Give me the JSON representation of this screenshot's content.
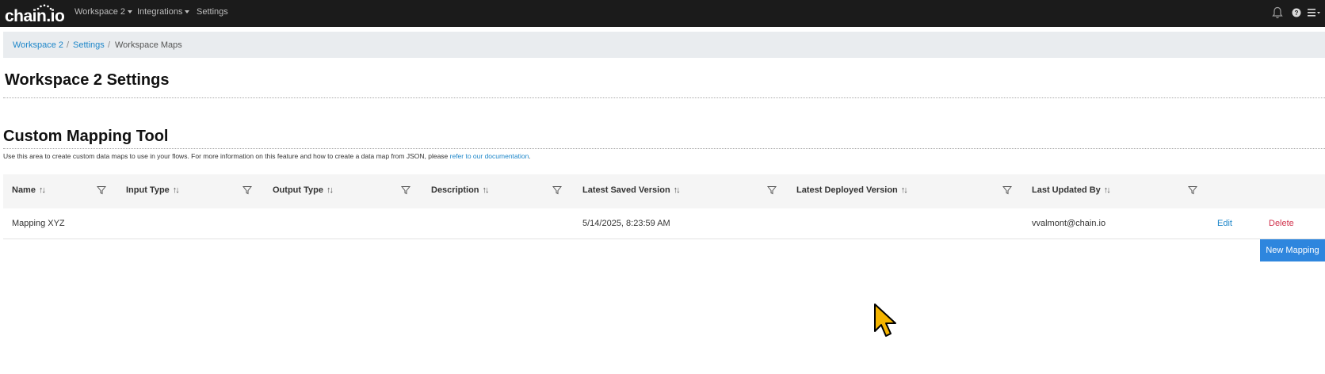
{
  "app": {
    "logo_text": "chain.io"
  },
  "nav": {
    "workspace_label": "Workspace 2",
    "integrations_label": "Integrations",
    "settings_label": "Settings"
  },
  "breadcrumb": {
    "items": [
      "Workspace 2",
      "Settings",
      "Workspace Maps"
    ],
    "separator": "/"
  },
  "page": {
    "title": "Workspace 2 Settings"
  },
  "section": {
    "title": "Custom Mapping Tool",
    "description": "Use this area to create custom data maps to use in your flows. For more information on this feature and how to create a data map from JSON, please ",
    "doc_link": "refer to our documentation",
    "doc_suffix": "."
  },
  "table": {
    "columns": [
      "Name",
      "Input Type",
      "Output Type",
      "Description",
      "Latest Saved Version",
      "Latest Deployed Version",
      "Last Updated By"
    ],
    "rows": [
      {
        "name": "Mapping XYZ",
        "input_type": "",
        "output_type": "",
        "description": "",
        "latest_saved_version": "5/14/2025, 8:23:59 AM",
        "latest_deployed_version": "",
        "last_updated_by": "vvalmont@chain.io",
        "edit_label": "Edit",
        "delete_label": "Delete"
      }
    ]
  },
  "actions": {
    "new_mapping_label": "New Mapping"
  },
  "icons": {
    "notifications": "bell-icon",
    "help": "help-icon",
    "menu": "hamburger-menu-icon",
    "sort": "sort-icon",
    "filter": "filter-icon"
  },
  "colors": {
    "topbar": "#1b1b1b",
    "link": "#1d86c9",
    "delete": "#d0314b",
    "primary_button": "#2e86de",
    "header_bg": "#f5f5f5",
    "breadcrumb_bg": "#e9ecef"
  }
}
